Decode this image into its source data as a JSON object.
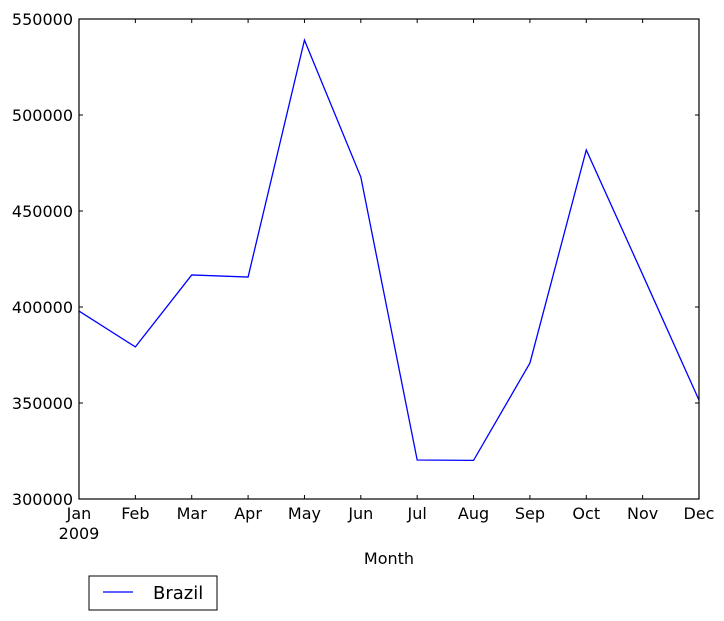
{
  "chart_data": {
    "type": "line",
    "title": "",
    "xlabel": "Month",
    "ylabel": "",
    "categories": [
      "Jan",
      "Feb",
      "Mar",
      "Apr",
      "May",
      "Jun",
      "Jul",
      "Aug",
      "Sep",
      "Oct",
      "Nov",
      "Dec"
    ],
    "x_sublabel": "2009",
    "ylim": [
      300000,
      550000
    ],
    "yticks": [
      300000,
      350000,
      400000,
      450000,
      500000,
      550000
    ],
    "ytick_labels": [
      "300000",
      "350000",
      "400000",
      "450000",
      "500000",
      "550000"
    ],
    "grid": false,
    "legend": {
      "position": "below-left",
      "entries": [
        "Brazil"
      ]
    },
    "series": [
      {
        "name": "Brazil",
        "color": "#0000ff",
        "values": [
          397900,
          379200,
          416700,
          415600,
          539000,
          467700,
          320300,
          320100,
          370800,
          481800,
          416900,
          351500
        ]
      }
    ]
  }
}
